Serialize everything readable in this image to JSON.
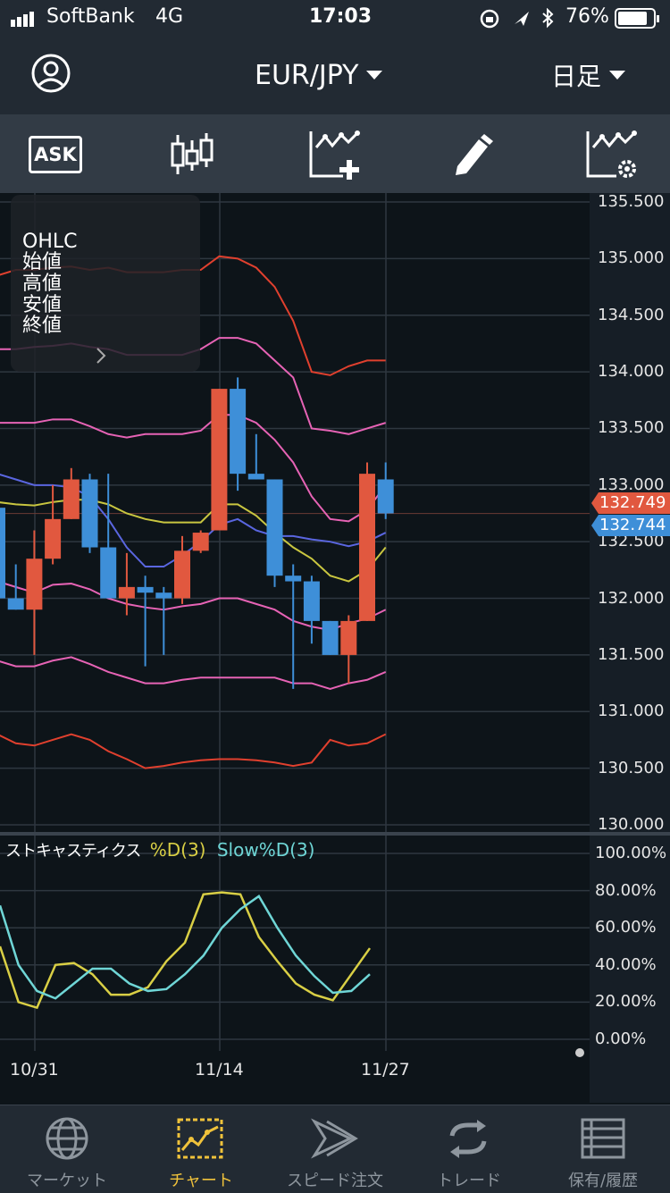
{
  "status": {
    "carrier": "SoftBank",
    "network": "4G",
    "time": "17:03",
    "battery": "76%"
  },
  "header": {
    "pair": "EUR/JPY",
    "timeframe": "日足"
  },
  "toolbar": {
    "ask_label": "ASK"
  },
  "ohlc_panel": {
    "title": "OHLC",
    "open": "始値",
    "high": "高値",
    "low": "安値",
    "close": "終値"
  },
  "price_axis": {
    "ticks": [
      "135.500",
      "135.000",
      "134.500",
      "134.000",
      "133.500",
      "133.000",
      "132.500",
      "132.000",
      "131.500",
      "131.000",
      "130.500",
      "130.000"
    ],
    "bid_badge": "132.749",
    "ask_badge": "132.744",
    "bid_color": "#e1583f",
    "ask_color": "#3e8fd8"
  },
  "stoch": {
    "title": "ストキャスティクス",
    "k_label": "%D(3)",
    "d_label": "Slow%D(3)",
    "ticks": [
      "100.00%",
      "80.00%",
      "60.00%",
      "40.00%",
      "20.00%",
      "0.00%"
    ]
  },
  "date_axis": {
    "labels": [
      "10/31",
      "11/14",
      "11/27"
    ]
  },
  "tabs": [
    {
      "label": "マーケット",
      "icon": "globe-icon"
    },
    {
      "label": "チャート",
      "icon": "chart-icon"
    },
    {
      "label": "スピード注文",
      "icon": "speed-order-icon"
    },
    {
      "label": "トレード",
      "icon": "trade-icon"
    },
    {
      "label": "保有/履歴",
      "icon": "list-icon"
    }
  ],
  "chart_data": [
    {
      "type": "candlestick",
      "ylim": [
        130.0,
        135.5
      ],
      "colors": {
        "up": "#e1583f",
        "down": "#3e8fd8"
      },
      "candles": [
        {
          "o": 132.8,
          "h": 133.0,
          "l": 131.5,
          "c": 132.0
        },
        {
          "o": 132.0,
          "h": 132.3,
          "l": 131.9,
          "c": 131.9
        },
        {
          "o": 131.9,
          "h": 132.6,
          "l": 131.5,
          "c": 132.35
        },
        {
          "o": 132.35,
          "h": 133.0,
          "l": 132.3,
          "c": 132.7
        },
        {
          "o": 132.7,
          "h": 133.15,
          "l": 132.7,
          "c": 133.05
        },
        {
          "o": 133.05,
          "h": 133.1,
          "l": 132.4,
          "c": 132.45
        },
        {
          "o": 132.45,
          "h": 133.1,
          "l": 132.0,
          "c": 132.0
        },
        {
          "o": 132.0,
          "h": 132.4,
          "l": 131.85,
          "c": 132.1
        },
        {
          "o": 132.1,
          "h": 132.2,
          "l": 131.4,
          "c": 132.05
        },
        {
          "o": 132.05,
          "h": 132.1,
          "l": 131.5,
          "c": 132.0
        },
        {
          "o": 132.0,
          "h": 132.55,
          "l": 131.95,
          "c": 132.42
        },
        {
          "o": 132.42,
          "h": 132.6,
          "l": 132.4,
          "c": 132.58
        },
        {
          "o": 132.6,
          "h": 133.85,
          "l": 132.6,
          "c": 133.85
        },
        {
          "o": 133.85,
          "h": 133.95,
          "l": 132.95,
          "c": 133.1
        },
        {
          "o": 133.1,
          "h": 133.45,
          "l": 133.05,
          "c": 133.05
        },
        {
          "o": 133.05,
          "h": 133.05,
          "l": 132.1,
          "c": 132.2
        },
        {
          "o": 132.2,
          "h": 132.3,
          "l": 131.2,
          "c": 132.15
        },
        {
          "o": 132.15,
          "h": 132.2,
          "l": 131.6,
          "c": 131.8
        },
        {
          "o": 131.8,
          "h": 131.8,
          "l": 131.5,
          "c": 131.5
        },
        {
          "o": 131.5,
          "h": 131.85,
          "l": 131.25,
          "c": 131.8
        },
        {
          "o": 131.8,
          "h": 133.2,
          "l": 131.8,
          "c": 133.1
        },
        {
          "o": 133.05,
          "h": 133.2,
          "l": 132.7,
          "c": 132.75
        }
      ],
      "overlays": [
        {
          "name": "sma",
          "color": "#c9c640",
          "values": [
            132.85,
            132.83,
            132.82,
            132.85,
            132.87,
            132.87,
            132.83,
            132.75,
            132.7,
            132.67,
            132.67,
            132.67,
            132.83,
            132.83,
            132.73,
            132.58,
            132.45,
            132.35,
            132.2,
            132.15,
            132.25,
            132.45
          ]
        },
        {
          "name": "ema",
          "color": "#5a66e0",
          "values": [
            133.1,
            133.05,
            133.0,
            133.0,
            132.98,
            132.9,
            132.7,
            132.45,
            132.28,
            132.28,
            132.38,
            132.5,
            132.65,
            132.7,
            132.6,
            132.55,
            132.55,
            132.52,
            132.5,
            132.46,
            132.5,
            132.58
          ]
        },
        {
          "name": "bb-upper-1",
          "color": "#e663b5",
          "values": [
            133.55,
            133.55,
            133.55,
            133.58,
            133.58,
            133.52,
            133.45,
            133.42,
            133.45,
            133.45,
            133.45,
            133.48,
            133.62,
            133.62,
            133.55,
            133.4,
            133.2,
            132.9,
            132.7,
            132.68,
            132.78,
            133.0
          ]
        },
        {
          "name": "bb-lower-1",
          "color": "#e663b5",
          "values": [
            132.15,
            132.1,
            132.05,
            132.12,
            132.13,
            132.08,
            132.0,
            131.95,
            131.92,
            131.9,
            131.93,
            131.95,
            132.0,
            132.0,
            131.95,
            131.9,
            131.8,
            131.75,
            131.72,
            131.78,
            131.82,
            131.9
          ]
        },
        {
          "name": "bb-upper-2",
          "color": "#e663b5",
          "values": [
            134.2,
            134.2,
            134.22,
            134.23,
            134.25,
            134.22,
            134.2,
            134.15,
            134.15,
            134.15,
            134.15,
            134.2,
            134.3,
            134.3,
            134.25,
            134.1,
            133.95,
            133.5,
            133.48,
            133.45,
            133.5,
            133.55
          ]
        },
        {
          "name": "bb-lower-2",
          "color": "#e663b5",
          "values": [
            131.45,
            131.4,
            131.4,
            131.45,
            131.48,
            131.42,
            131.35,
            131.3,
            131.25,
            131.25,
            131.28,
            131.3,
            131.3,
            131.3,
            131.3,
            131.3,
            131.25,
            131.25,
            131.2,
            131.25,
            131.28,
            131.35
          ]
        },
        {
          "name": "bb-upper-3",
          "color": "#e0402e",
          "values": [
            134.85,
            134.9,
            134.9,
            134.92,
            134.93,
            134.9,
            134.92,
            134.88,
            134.88,
            134.88,
            134.9,
            134.9,
            135.02,
            135.0,
            134.92,
            134.75,
            134.45,
            134.0,
            133.97,
            134.05,
            134.1,
            134.1
          ]
        },
        {
          "name": "bb-lower-3",
          "color": "#e0402e",
          "values": [
            130.8,
            130.72,
            130.7,
            130.75,
            130.8,
            130.75,
            130.65,
            130.58,
            130.5,
            130.52,
            130.55,
            130.57,
            130.58,
            130.58,
            130.57,
            130.55,
            130.52,
            130.55,
            130.75,
            130.7,
            130.72,
            130.8
          ]
        }
      ]
    },
    {
      "type": "line",
      "title": "ストキャスティクス",
      "ylim": [
        0,
        100
      ],
      "series": [
        {
          "name": "%D(3)",
          "color": "#d9cf45",
          "values": [
            50,
            20,
            17,
            40,
            41,
            35,
            24,
            24,
            28,
            42,
            52,
            78,
            79,
            78,
            55,
            42,
            30,
            24,
            21,
            35,
            49
          ]
        },
        {
          "name": "Slow%D(3)",
          "color": "#6fd6d6",
          "values": [
            72,
            40,
            26,
            22,
            30,
            38,
            38,
            30,
            26,
            27,
            35,
            45,
            60,
            70,
            77,
            60,
            45,
            34,
            25,
            26,
            35
          ]
        }
      ]
    }
  ]
}
